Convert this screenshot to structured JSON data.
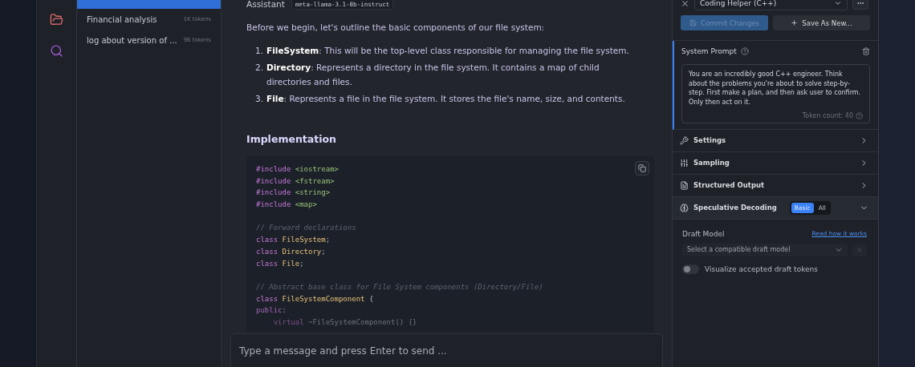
{
  "rail": {
    "items": [
      {
        "kind": "folder",
        "selected": false
      },
      {
        "kind": "search",
        "selected": false
      }
    ]
  },
  "chats": [
    {
      "selected": true
    },
    {
      "title": "Financial analysis",
      "tokens": "1K tokens",
      "selected": false
    },
    {
      "title": "log about version of ...",
      "tokens": "96 tokens",
      "selected": false
    }
  ],
  "message": {
    "role": "Assistant",
    "model": "meta-llama-3.1-8b-instruct",
    "intro": "Before we begin, let's outline the basic components of our file system:",
    "list": [
      {
        "number": "1.",
        "text": "**FileSystem**: This will be the top-level class responsible for managing the file system."
      },
      {
        "number": "2.",
        "text": "**Directory**: Represents a directory in the file system. It contains a map of child directories and files."
      },
      {
        "number": "3.",
        "text": "**File**: Represents a file in the file system. It stores the file's name, size, and contents."
      }
    ],
    "heading": "Implementation",
    "code": [
      {
        "kind": "code",
        "tokens": [
          {
            "kind": "keyword",
            "text": "#include"
          },
          {
            "kind": "string",
            "text": " <iostream>"
          }
        ]
      },
      {
        "kind": "code",
        "tokens": [
          {
            "kind": "keyword",
            "text": "#include"
          },
          {
            "kind": "string",
            "text": " <fstream>"
          }
        ]
      },
      {
        "kind": "code",
        "tokens": [
          {
            "kind": "keyword",
            "text": "#include"
          },
          {
            "kind": "string",
            "text": " <string>"
          }
        ]
      },
      {
        "kind": "code",
        "tokens": [
          {
            "kind": "keyword",
            "text": "#include"
          },
          {
            "kind": "string",
            "text": " <map>"
          }
        ]
      },
      {
        "kind": "blank"
      },
      {
        "kind": "code",
        "tokens": [
          {
            "kind": "comment",
            "text": "// Forward declarations"
          }
        ]
      },
      {
        "kind": "code",
        "tokens": [
          {
            "kind": "keyword",
            "text": "class"
          },
          {
            "kind": "type",
            "text": " FileSystem"
          },
          {
            "kind": "plain",
            "text": ";"
          }
        ]
      },
      {
        "kind": "code",
        "tokens": [
          {
            "kind": "keyword",
            "text": "class"
          },
          {
            "kind": "type",
            "text": " Directory"
          },
          {
            "kind": "plain",
            "text": ";"
          }
        ]
      },
      {
        "kind": "code",
        "tokens": [
          {
            "kind": "keyword",
            "text": "class"
          },
          {
            "kind": "type",
            "text": " File"
          },
          {
            "kind": "plain",
            "text": ";"
          }
        ]
      },
      {
        "kind": "blank"
      },
      {
        "kind": "code",
        "tokens": [
          {
            "kind": "comment",
            "text": "// Abstract base class for File System components (Directory/File)"
          }
        ]
      },
      {
        "kind": "code",
        "tokens": [
          {
            "kind": "keyword",
            "text": "class"
          },
          {
            "kind": "type",
            "text": " FileSystemComponent"
          },
          {
            "kind": "plain",
            "text": " {"
          }
        ]
      },
      {
        "kind": "code",
        "tokens": [
          {
            "kind": "keyword",
            "text": "public"
          },
          {
            "kind": "plain",
            "text": ":"
          }
        ]
      },
      {
        "kind": "indented",
        "tokens": [
          {
            "kind": "keyword",
            "text": "virtual"
          },
          {
            "kind": "plain",
            "text": " ~FileSystemComponent() {}"
          }
        ]
      }
    ]
  },
  "composer": {
    "placeholder": "Type a message and press Enter to send ..."
  },
  "panel": {
    "preset": "Coding Helper (C++)",
    "commit": {
      "label": "Commit Changes",
      "disabled": true
    },
    "save_as": "Save As New...",
    "system_prompt": {
      "title": "System Prompt",
      "text": "You are an incredibly good C++ engineer. Think about the problems you're about to solve step-by-step. First make a plan, and then ask user to confirm. Only then act on it.",
      "token_count": "Token count: 40"
    },
    "sections": [
      {
        "kind": "settings",
        "title": "Settings",
        "expanded": false
      },
      {
        "kind": "sampling",
        "title": "Sampling",
        "expanded": false
      },
      {
        "kind": "structured",
        "title": "Structured Output",
        "expanded": false
      },
      {
        "kind": "speculative",
        "title": "Speculative Decoding",
        "expanded": true,
        "modes": [
          {
            "label": "Basic",
            "selected": true
          },
          {
            "label": "All",
            "selected": false
          }
        ]
      }
    ],
    "draft_model": {
      "label": "Draft Model",
      "link": "Read how it works",
      "placeholder": "Select a compatible draft model"
    },
    "visualize": {
      "label": "Visualize accepted draft tokens",
      "on": false
    }
  }
}
